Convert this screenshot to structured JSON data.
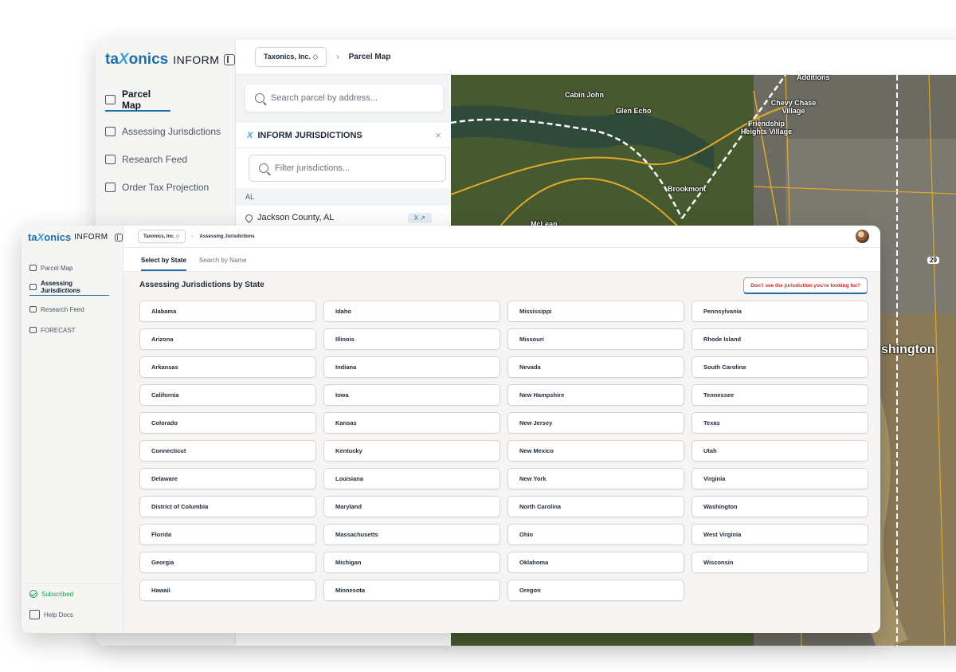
{
  "back_window": {
    "logo": {
      "ta": "ta",
      "x": "X",
      "onics": "onics",
      "product": "INFORM"
    },
    "nav": [
      {
        "label": "Parcel Map",
        "icon": "map-icon"
      },
      {
        "label": "Assessing Jurisdictions",
        "icon": "bank-icon"
      },
      {
        "label": "Research Feed",
        "icon": "feed-icon"
      },
      {
        "label": "Order Tax Projection",
        "icon": "table-icon"
      }
    ],
    "org": "Taxonics, Inc. ◇",
    "breadcrumb_page": "Parcel Map",
    "search_placeholder": "Search parcel by address...",
    "jurisdictions_title": "INFORM JURISDICTIONS",
    "close": "×",
    "filter_placeholder": "Filter jurisdictions...",
    "group": "AL",
    "row": "Jackson County, AL",
    "row_button": "X ↗",
    "map_labels": [
      "Cabin John",
      "Glen Echo",
      "Chevy Chase Village",
      "Friendship Heights Village",
      "Brookmont",
      "Additions",
      "McLean",
      "shington",
      "29"
    ]
  },
  "front_window": {
    "logo": {
      "ta": "ta",
      "x": "X",
      "onics": "onics",
      "product": "INFORM"
    },
    "nav": [
      {
        "label": "Parcel Map",
        "icon": "map-icon"
      },
      {
        "label": "Assessing Jurisdictions",
        "icon": "bank-icon"
      },
      {
        "label": "Research Feed",
        "icon": "feed-icon"
      },
      {
        "label": "FORECAST",
        "icon": "table-icon"
      }
    ],
    "bottom_nav": {
      "subscribed": "Subscribed",
      "help": "Help Docs"
    },
    "org": "Taxonics, Inc. ◇",
    "breadcrumb_page": "Assessing Jurisdictions",
    "tabs": [
      "Select by State",
      "Search by Name"
    ],
    "title": "Assessing Jurisdictions by State",
    "help_button": "Don't see the jurisdiction you're looking for?",
    "states": [
      "Alabama",
      "Arizona",
      "Arkansas",
      "California",
      "Colorado",
      "Connecticut",
      "Delaware",
      "District of Columbia",
      "Florida",
      "Georgia",
      "Hawaii",
      "Idaho",
      "Illinois",
      "Indiana",
      "Iowa",
      "Kansas",
      "Kentucky",
      "Louisiana",
      "Maryland",
      "Massachusetts",
      "Michigan",
      "Minnesota",
      "Mississippi",
      "Missouri",
      "Nevada",
      "New Hampshire",
      "New Jersey",
      "New Mexico",
      "New York",
      "North Carolina",
      "Ohio",
      "Oklahoma",
      "Oregon",
      "Pennsylvania",
      "Rhode Island",
      "South Carolina",
      "Tennessee",
      "Texas",
      "Utah",
      "Virginia",
      "Washington",
      "West Virginia",
      "Wisconsin"
    ]
  }
}
